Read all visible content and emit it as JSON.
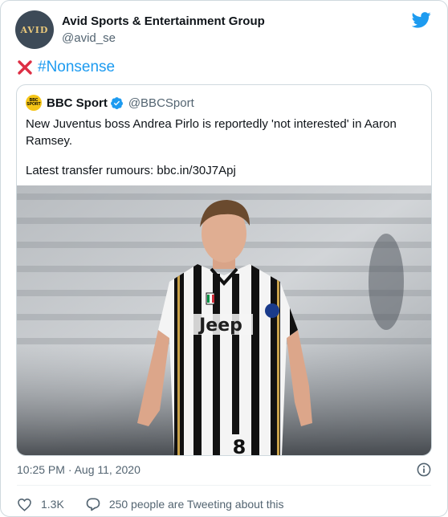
{
  "author": {
    "avatar_text": "AVID",
    "name": "Avid Sports & Entertainment Group",
    "handle": "@avid_se"
  },
  "tweet": {
    "hashtag": "#Nonsense"
  },
  "quoted": {
    "avatar_text": "BBC SPORT",
    "name": "BBC Sport",
    "handle": "@BBCSport",
    "body": "New Juventus boss Andrea Pirlo is reportedly 'not interested' in Aaron Ramsey.",
    "link_line": "Latest transfer rumours: bbc.in/30J7Apj",
    "photo_shirt_text": "Jeep",
    "photo_number": "8"
  },
  "footer": {
    "timestamp": "10:25 PM · Aug 11, 2020",
    "like_count": "1.3K",
    "reply_text": "250 people are Tweeting about this"
  },
  "colors": {
    "link_blue": "#1d9bf0",
    "verified_blue": "#1d9bf0",
    "muted_text": "#536471",
    "x_mark_red": "#dd2e44",
    "heart_outline": "#536471"
  }
}
